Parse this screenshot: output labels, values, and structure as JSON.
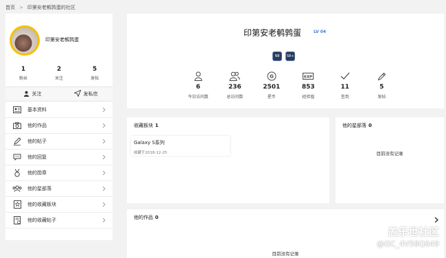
{
  "breadcrumb": {
    "home": "首页",
    "separator": ">",
    "current": "印第安老鹌鹑蛋的社区"
  },
  "profile": {
    "username": "印第安老鹌鹑蛋",
    "stats": [
      {
        "value": "1",
        "label": "粉丝"
      },
      {
        "value": "2",
        "label": "关注"
      },
      {
        "value": "5",
        "label": "发帖"
      }
    ],
    "follow_label": "关注",
    "message_label": "发私信"
  },
  "menu": [
    {
      "label": "基本资料",
      "icon": "profile-card-icon"
    },
    {
      "label": "他的作品",
      "icon": "camera-icon"
    },
    {
      "label": "他的帖子",
      "icon": "pen-icon"
    },
    {
      "label": "他的回复",
      "icon": "comment-icon"
    },
    {
      "label": "他的勋章",
      "icon": "medal-icon"
    },
    {
      "label": "他的星部落",
      "icon": "group-icon"
    },
    {
      "label": "他的收藏板块",
      "icon": "star-board-icon"
    },
    {
      "label": "他的收藏帖子",
      "icon": "bookmark-post-icon"
    }
  ],
  "header": {
    "title": "印第安老鹌鹑蛋",
    "level": "LV 04",
    "badges": [
      "N8",
      "S8+"
    ],
    "stats": [
      {
        "value": "6",
        "label": "今日访问数",
        "icon": "person-icon"
      },
      {
        "value": "236",
        "label": "总访问数",
        "icon": "people-icon"
      },
      {
        "value": "2501",
        "label": "星币",
        "icon": "coin-icon"
      },
      {
        "value": "853",
        "label": "经验值",
        "icon": "exp-icon"
      },
      {
        "value": "11",
        "label": "签到",
        "icon": "check-icon"
      },
      {
        "value": "5",
        "label": "发帖",
        "icon": "pencil-icon"
      }
    ]
  },
  "fav_boards": {
    "title": "收藏板块",
    "count": "1",
    "item": {
      "name": "Galaxy S系列",
      "date": "收藏于2018-12-25"
    }
  },
  "star_tribe": {
    "title": "他的星部落",
    "count": "0",
    "empty": "目前没有记录"
  },
  "works": {
    "title": "他的作品",
    "count": "0",
    "empty": "目前没有记录"
  },
  "watermark": {
    "line1": "盖乐世社区",
    "line2": "@GC_4V58Q649"
  },
  "colors": {
    "avatar_ring": "#f5c100",
    "level": "#3a7fd5",
    "background": "#f2f2f2"
  }
}
